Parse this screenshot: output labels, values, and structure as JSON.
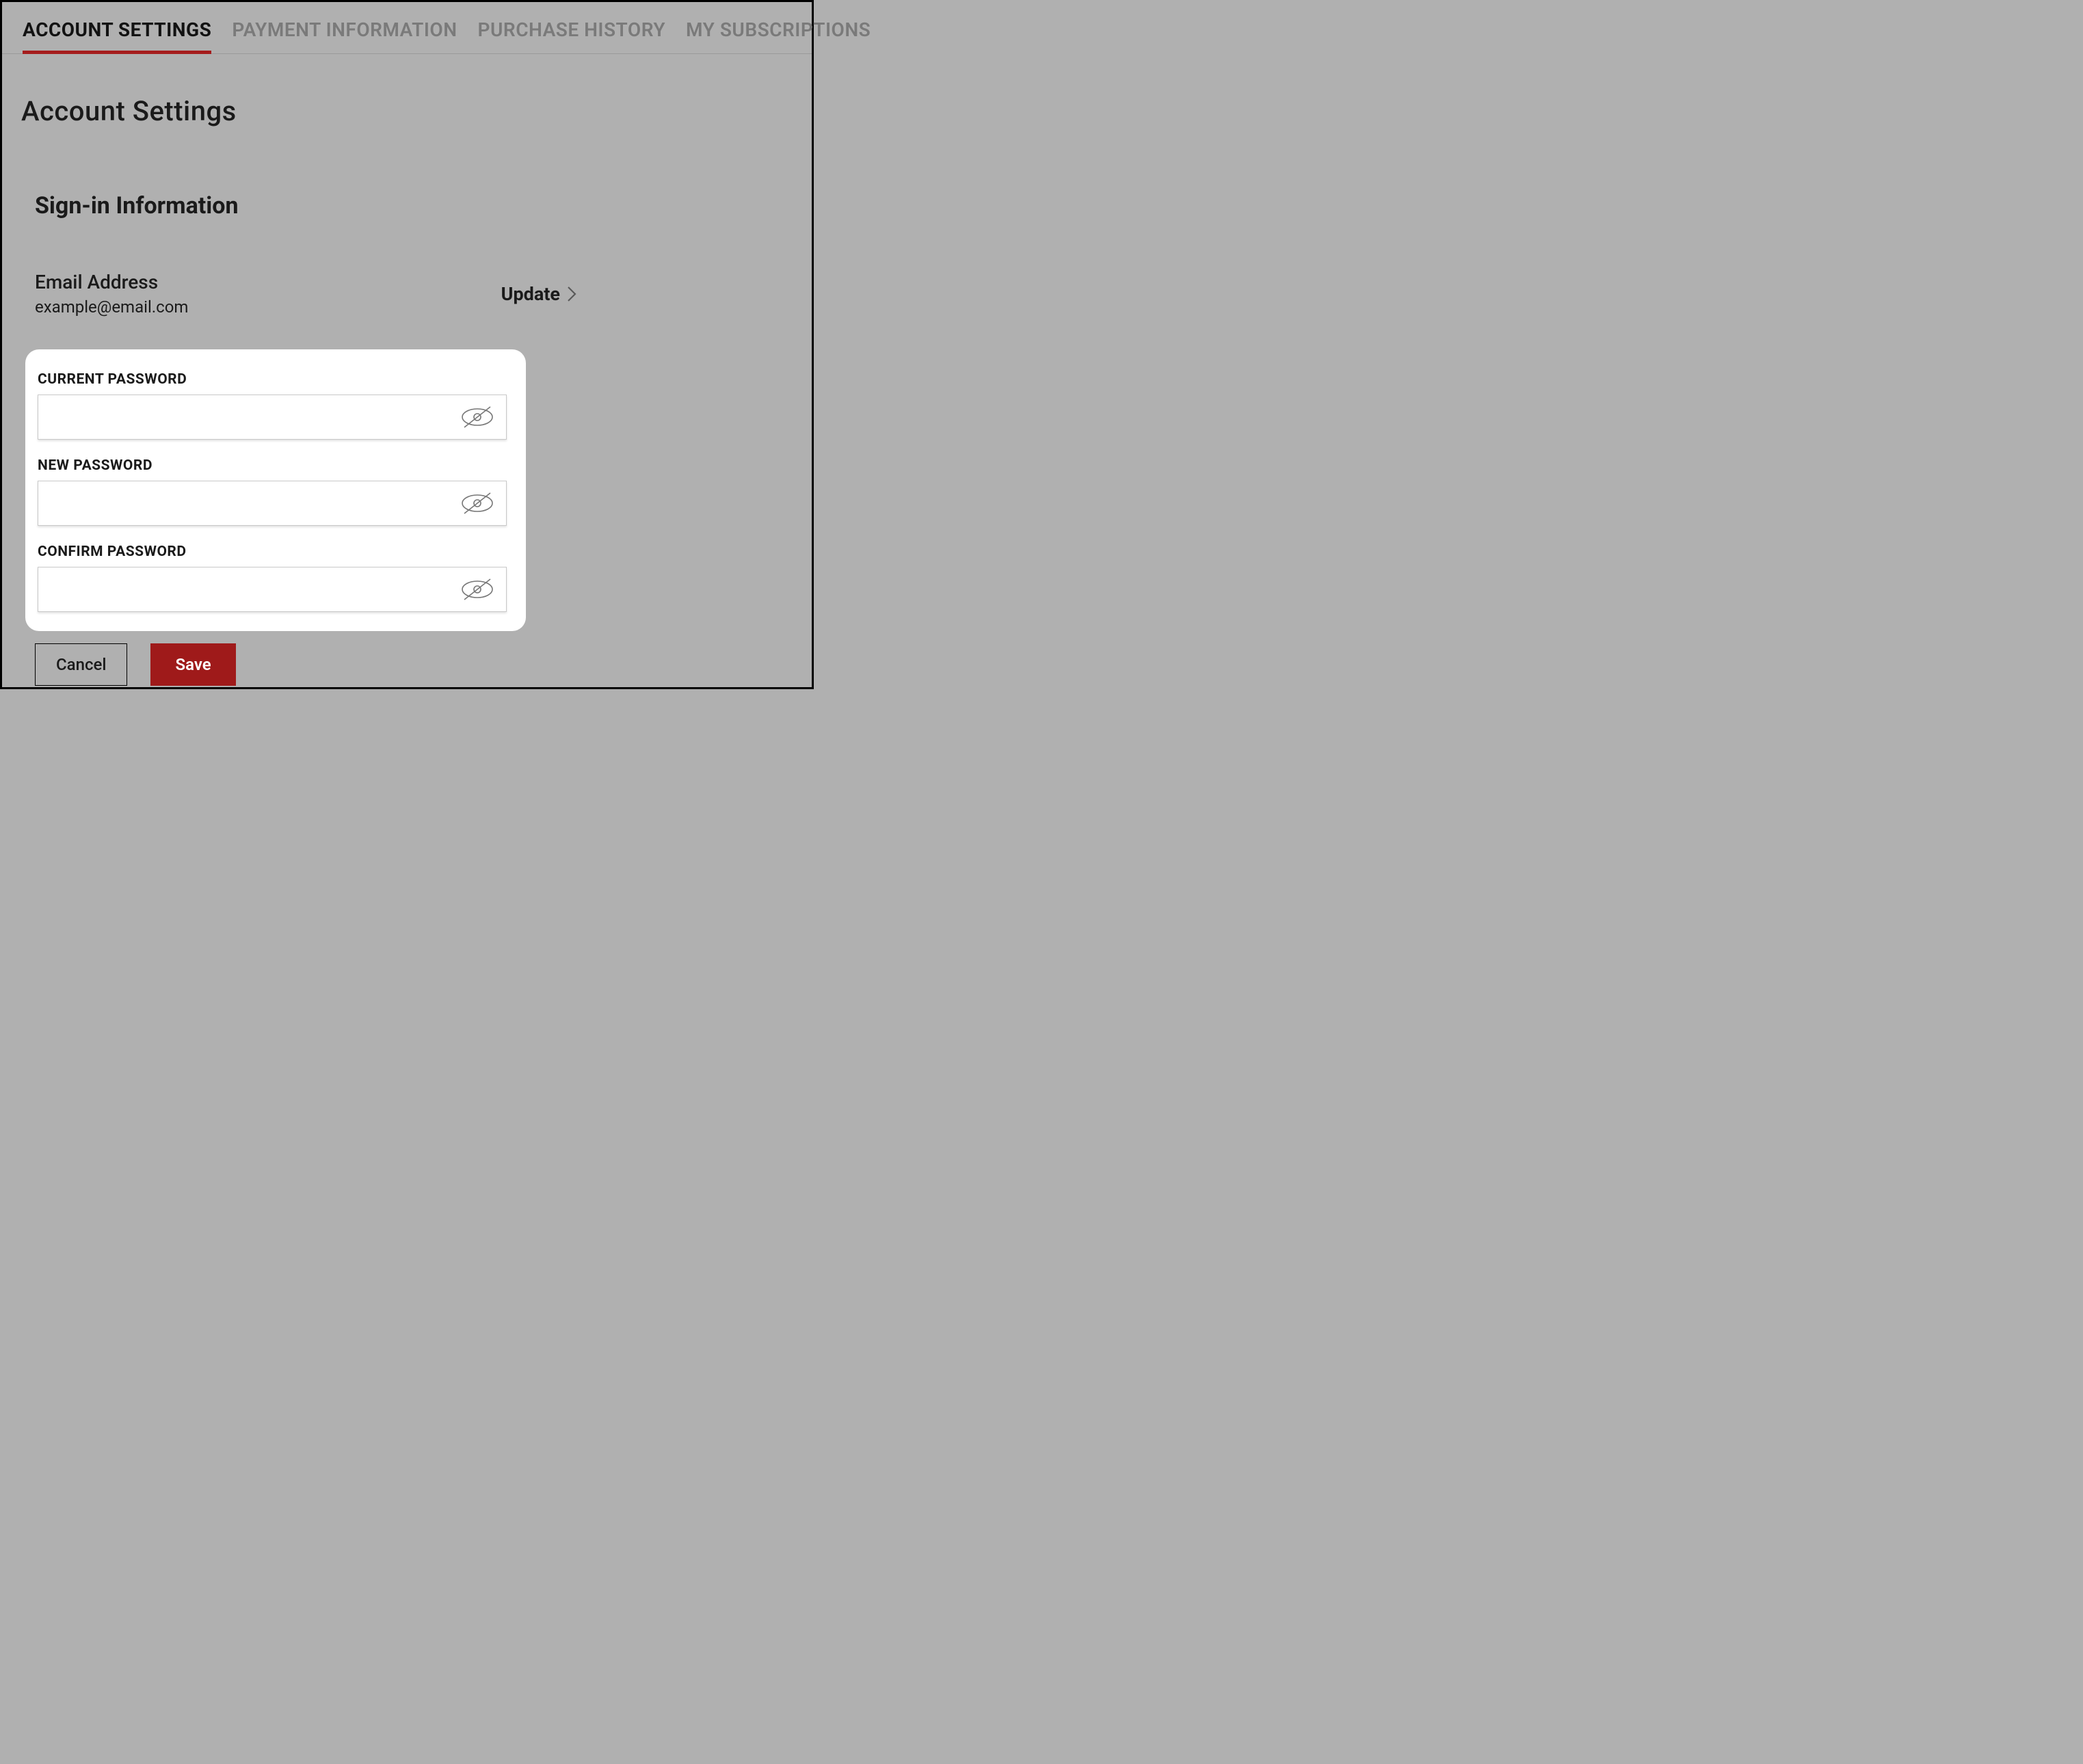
{
  "tabs": [
    {
      "label": "ACCOUNT SETTINGS",
      "active": true
    },
    {
      "label": "PAYMENT INFORMATION",
      "active": false
    },
    {
      "label": "PURCHASE HISTORY",
      "active": false
    },
    {
      "label": "MY SUBSCRIPTIONS",
      "active": false
    }
  ],
  "page": {
    "title": "Account Settings",
    "section_title": "Sign-in Information"
  },
  "email": {
    "label": "Email Address",
    "value": "example@email.com",
    "update_label": "Update"
  },
  "password_form": {
    "current_label": "CURRENT PASSWORD",
    "new_label": "NEW PASSWORD",
    "confirm_label": "CONFIRM PASSWORD",
    "current_value": "",
    "new_value": "",
    "confirm_value": ""
  },
  "buttons": {
    "cancel": "Cancel",
    "save": "Save"
  },
  "colors": {
    "accent": "#9f1a1a",
    "background": "#b0b0b0",
    "card": "#ffffff"
  }
}
